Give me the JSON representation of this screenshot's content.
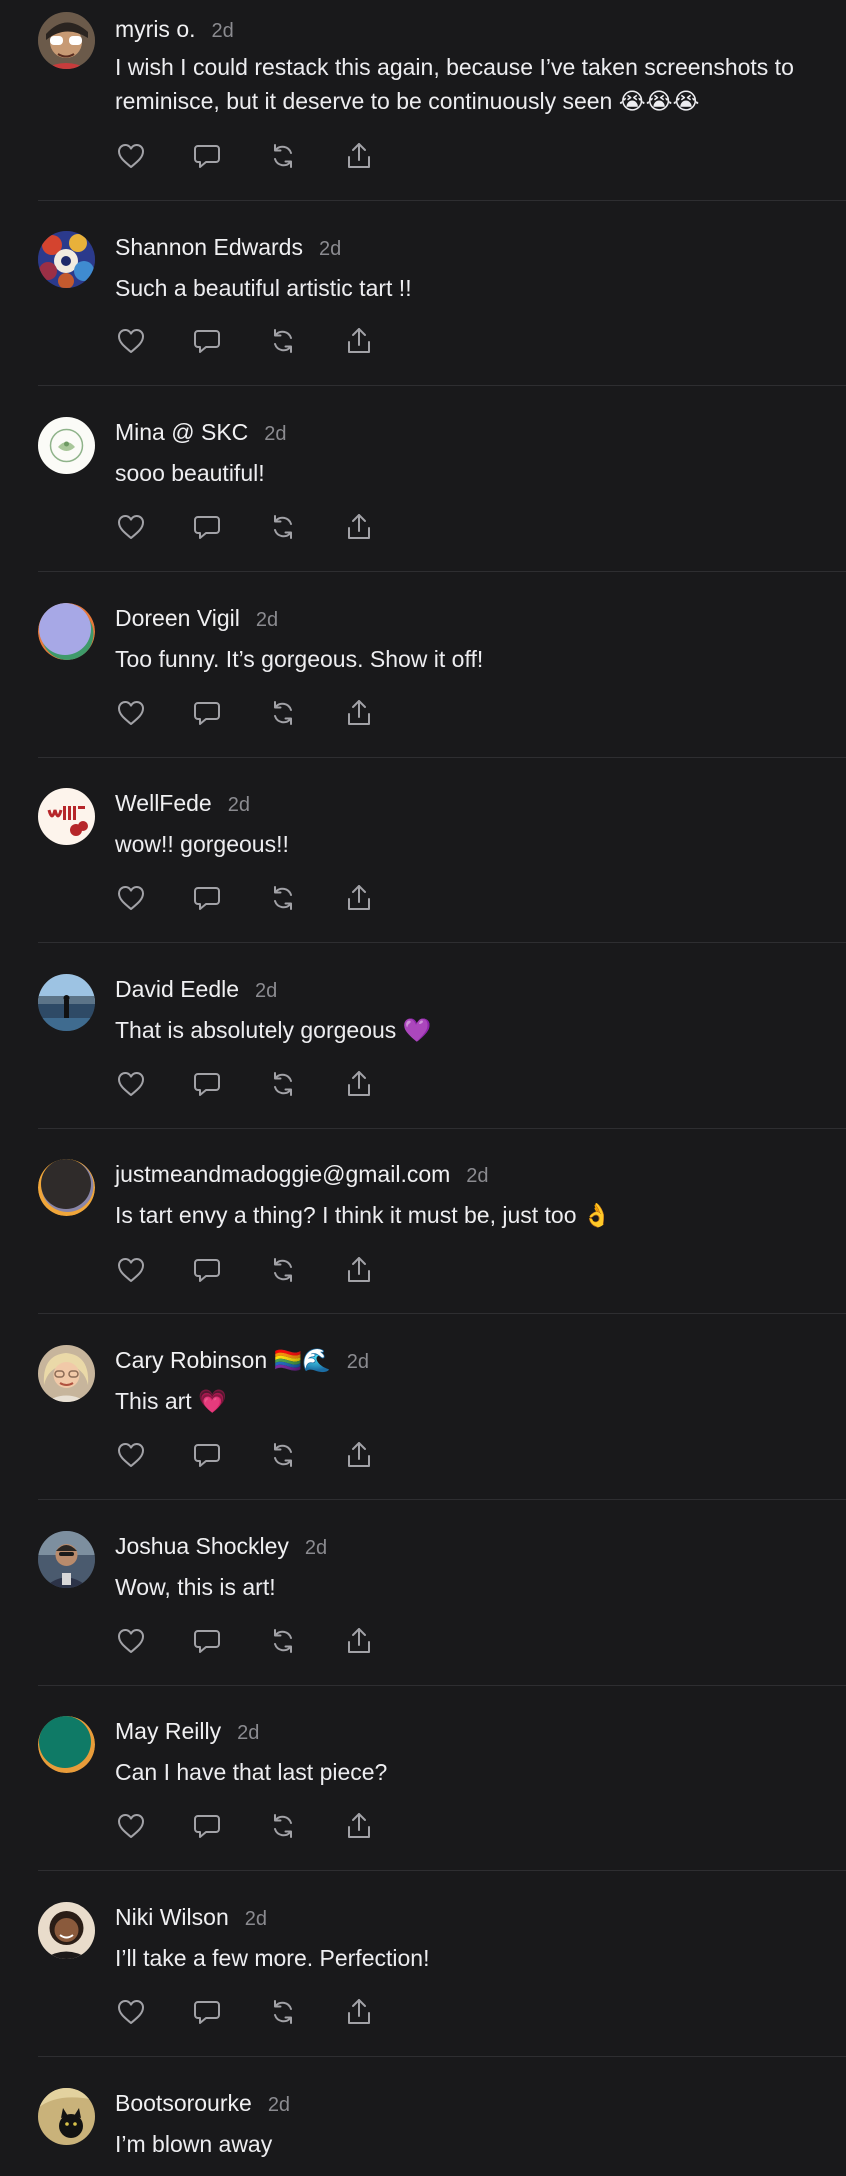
{
  "comments": [
    {
      "name": "myris o.",
      "time": "2d",
      "text": "I wish I could restack this again, because I’ve taken screenshots to reminisce, but it deserve to be continuously seen 😭😭😭",
      "avatar": "face-sunglasses"
    },
    {
      "name": "Shannon Edwards",
      "time": "2d",
      "text": "Such a beautiful artistic tart !!",
      "avatar": "mosaic"
    },
    {
      "name": "Mina @ SKC",
      "time": "2d",
      "text": "sooo beautiful!",
      "avatar": "green-badge"
    },
    {
      "name": "Doreen Vigil",
      "time": "2d",
      "text": "Too funny. It’s gorgeous. Show it off!",
      "avatar": "lavender-disc"
    },
    {
      "name": "WellFede",
      "time": "2d",
      "text": "wow!! gorgeous!!",
      "avatar": "wellfede-logo"
    },
    {
      "name": "David Eedle",
      "time": "2d",
      "text": "That is absolutely gorgeous 💜",
      "avatar": "lake-figure"
    },
    {
      "name": "justmeandmadoggie@gmail.com",
      "time": "2d",
      "text": "Is tart envy a thing? I think it must be, just too 👌",
      "avatar": "dark-disc"
    },
    {
      "name": "Cary Robinson 🏳️‍🌈🌊",
      "time": "2d",
      "text": "This art 💗",
      "avatar": "blonde-woman"
    },
    {
      "name": "Joshua Shockley",
      "time": "2d",
      "text": "Wow, this is art!",
      "avatar": "man-portrait"
    },
    {
      "name": "May Reilly",
      "time": "2d",
      "text": "Can I have that last piece?",
      "avatar": "teal-disc"
    },
    {
      "name": "Niki Wilson",
      "time": "2d",
      "text": "I’ll take a few more. Perfection!",
      "avatar": "woman-portrait"
    },
    {
      "name": "Bootsorourke",
      "time": "2d",
      "text": "I’m blown away",
      "avatar": "black-cat"
    }
  ],
  "actions": [
    "like-icon",
    "reply-icon",
    "restack-icon",
    "share-icon"
  ],
  "colors": {
    "background": "#19191b",
    "text": "#ececee",
    "muted": "#8b8b90",
    "divider": "#2e2e31",
    "icon": "#a2a2a7"
  }
}
